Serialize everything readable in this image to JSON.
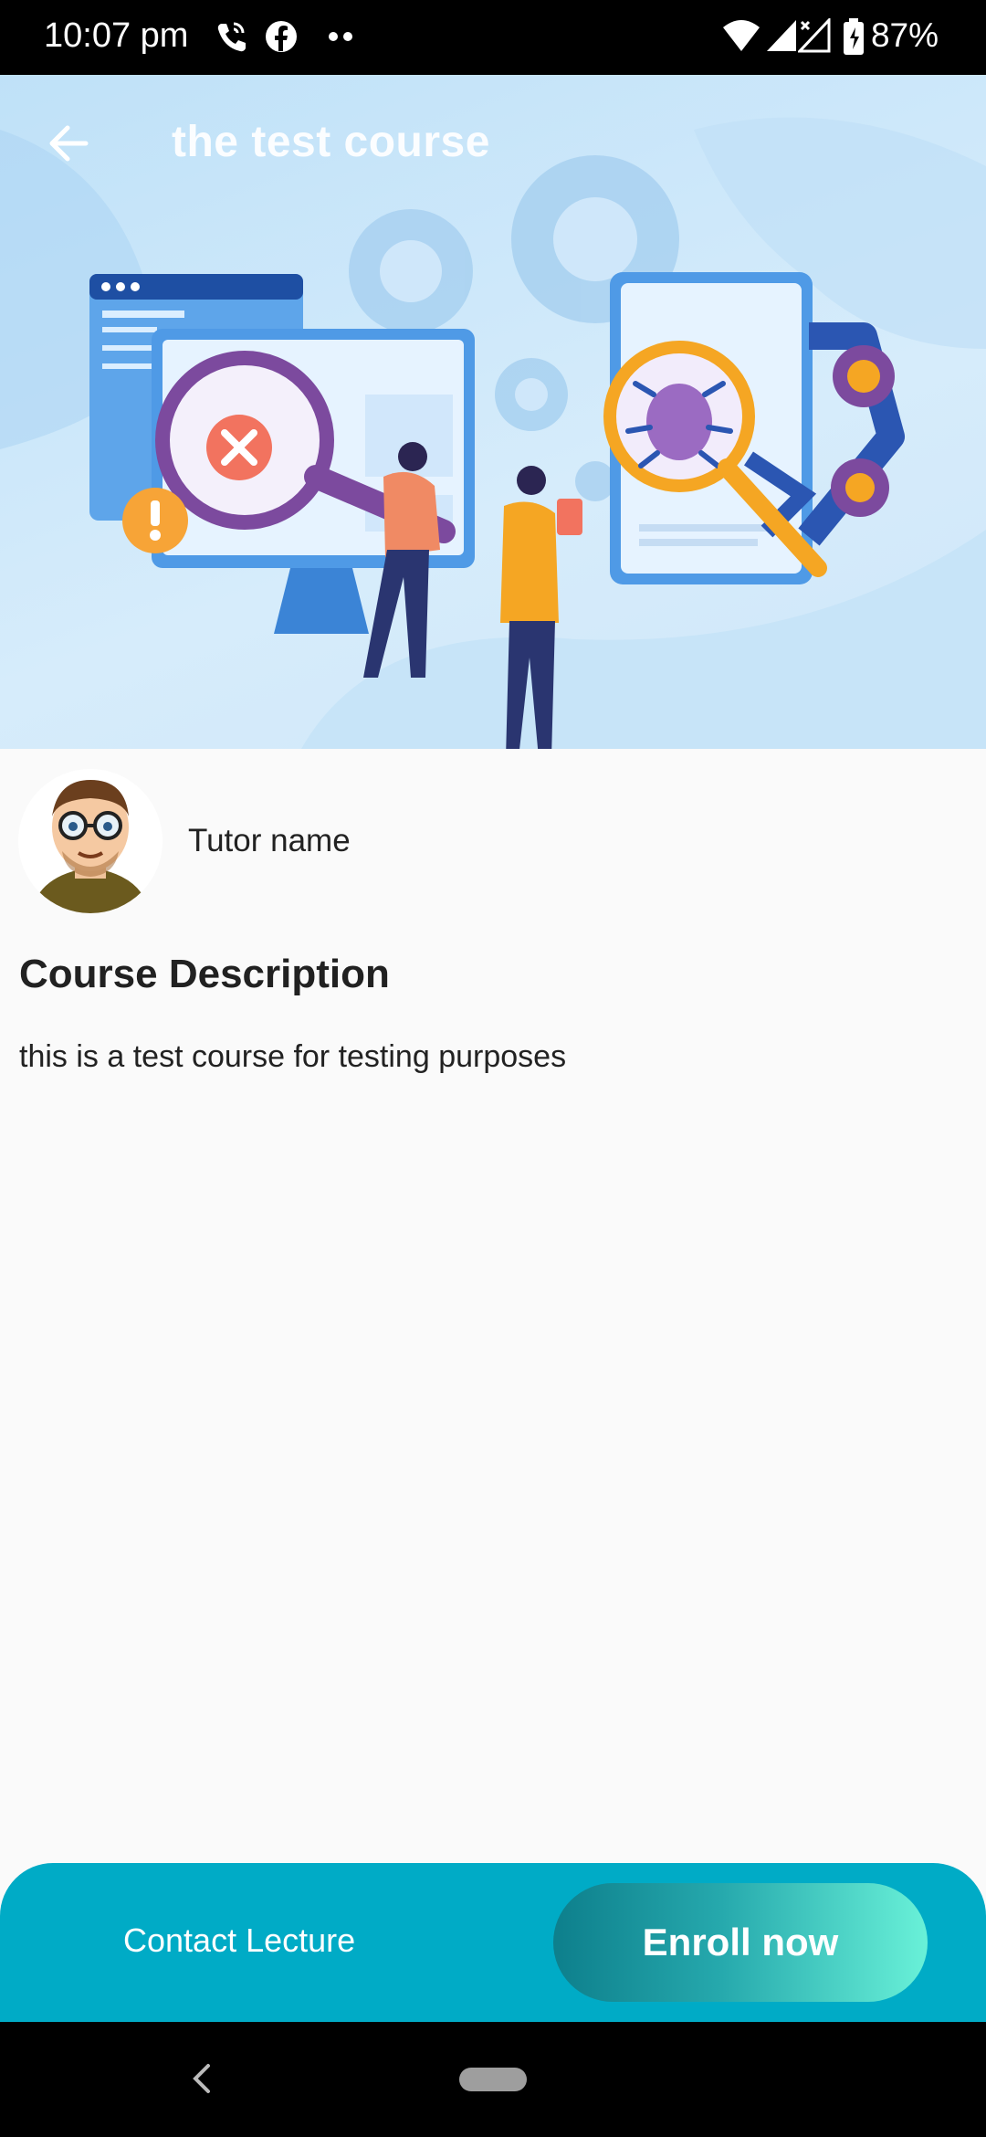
{
  "status_bar": {
    "time": "10:07 pm",
    "battery": "87%",
    "icons": [
      "wifi-calling-icon",
      "facebook-icon",
      "more-dots-icon",
      "wifi-icon",
      "signal-icon",
      "signal-x-icon",
      "battery-icon"
    ]
  },
  "header": {
    "title": "the test course",
    "back_icon": "back-arrow-icon"
  },
  "tutor": {
    "name": "Tutor name"
  },
  "description": {
    "heading": "Course Description",
    "text": "this is a test course for testing purposes"
  },
  "actions": {
    "contact_label": "Contact Lecture",
    "enroll_label": "Enroll now"
  },
  "colors": {
    "bottom_bar": "#00abc6",
    "enroll_gradient_start": "#0d7f8c",
    "enroll_gradient_end": "#69f1d8"
  }
}
